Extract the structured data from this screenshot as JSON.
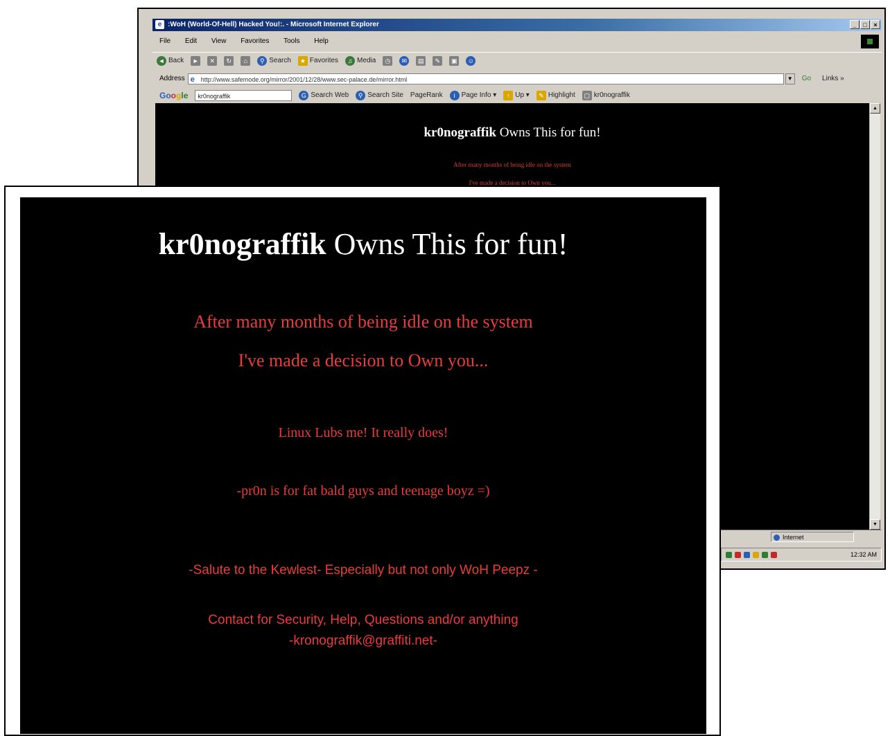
{
  "browser": {
    "title": ":WoH (World-Of-Hell) Hacked You!:. - Microsoft Internet Explorer",
    "window_buttons": [
      "_",
      "□",
      "×"
    ],
    "menu": [
      "File",
      "Edit",
      "View",
      "Favorites",
      "Tools",
      "Help"
    ],
    "toolbar": [
      {
        "icon": "back-icon",
        "glyph": "◄",
        "label": "Back"
      },
      {
        "icon": "forward-icon",
        "glyph": "►",
        "label": ""
      },
      {
        "icon": "stop-icon",
        "glyph": "✕",
        "label": ""
      },
      {
        "icon": "refresh-icon",
        "glyph": "↻",
        "label": ""
      },
      {
        "icon": "home-icon",
        "glyph": "⌂",
        "label": ""
      },
      {
        "icon": "search-icon",
        "glyph": "⚲",
        "label": "Search"
      },
      {
        "icon": "favorites-icon",
        "glyph": "★",
        "label": "Favorites"
      },
      {
        "icon": "media-icon",
        "glyph": "♫",
        "label": "Media"
      },
      {
        "icon": "history-icon",
        "glyph": "◷",
        "label": ""
      },
      {
        "icon": "mail-icon",
        "glyph": "✉",
        "label": ""
      },
      {
        "icon": "print-icon",
        "glyph": "▤",
        "label": ""
      },
      {
        "icon": "edit-icon",
        "glyph": "✎",
        "label": ""
      },
      {
        "icon": "discuss-icon",
        "glyph": "▣",
        "label": ""
      },
      {
        "icon": "messenger-icon",
        "glyph": "☺",
        "label": ""
      }
    ],
    "address_label": "Address",
    "address_value": "http://www.safemode.org/mirror/2001/12/28/www.sec-palace.de/mirror.html",
    "go_label": "Go",
    "links_label": "Links »",
    "google_logo": [
      "Go",
      "o",
      "g",
      "le"
    ],
    "google_query": "kr0nograffik",
    "google_buttons": [
      {
        "icon": "search-web-icon",
        "label": "Search Web"
      },
      {
        "icon": "search-site-icon",
        "label": "Search Site"
      },
      {
        "icon": "pagerank-icon",
        "label": "PageRank"
      },
      {
        "icon": "page-info-icon",
        "label": "Page Info ▾"
      },
      {
        "icon": "up-icon",
        "label": "Up ▾"
      },
      {
        "icon": "highlight-icon",
        "label": "Highlight"
      },
      {
        "icon": "word-find-icon",
        "label": "kr0nograffik"
      }
    ],
    "status_zone": "Internet",
    "clock": "12:32 AM",
    "tray_colors": [
      "#2e7d32",
      "#c62828",
      "#2c5fb4",
      "#d9a800",
      "#2e7d32",
      "#c62828"
    ]
  },
  "small_page": {
    "title_bold": "kr0nograffik",
    "title_rest": " Owns This for fun!",
    "line1": "After many months of being idle on the system",
    "line2": "I've made a decision to Own you..."
  },
  "page": {
    "title_bold": "kr0nograffik",
    "title_rest": " Owns This for fun!",
    "line1": "After many months of being idle on the system",
    "line2": "I've made a decision to Own you...",
    "line3": "Linux Lubs me! It really does!",
    "line4": "-pr0n is for fat bald guys and teenage boyz =)",
    "line5": "-Salute to the Kewlest- Especially but not only WoH Peepz -",
    "contact_line": "Contact for Security, Help, Questions and/or anything",
    "email": "-kronograffik@graffiti.net-"
  },
  "colors": {
    "accent_red": "#ec3b3b",
    "title_white": "#ffffff",
    "page_background": "#000000"
  }
}
